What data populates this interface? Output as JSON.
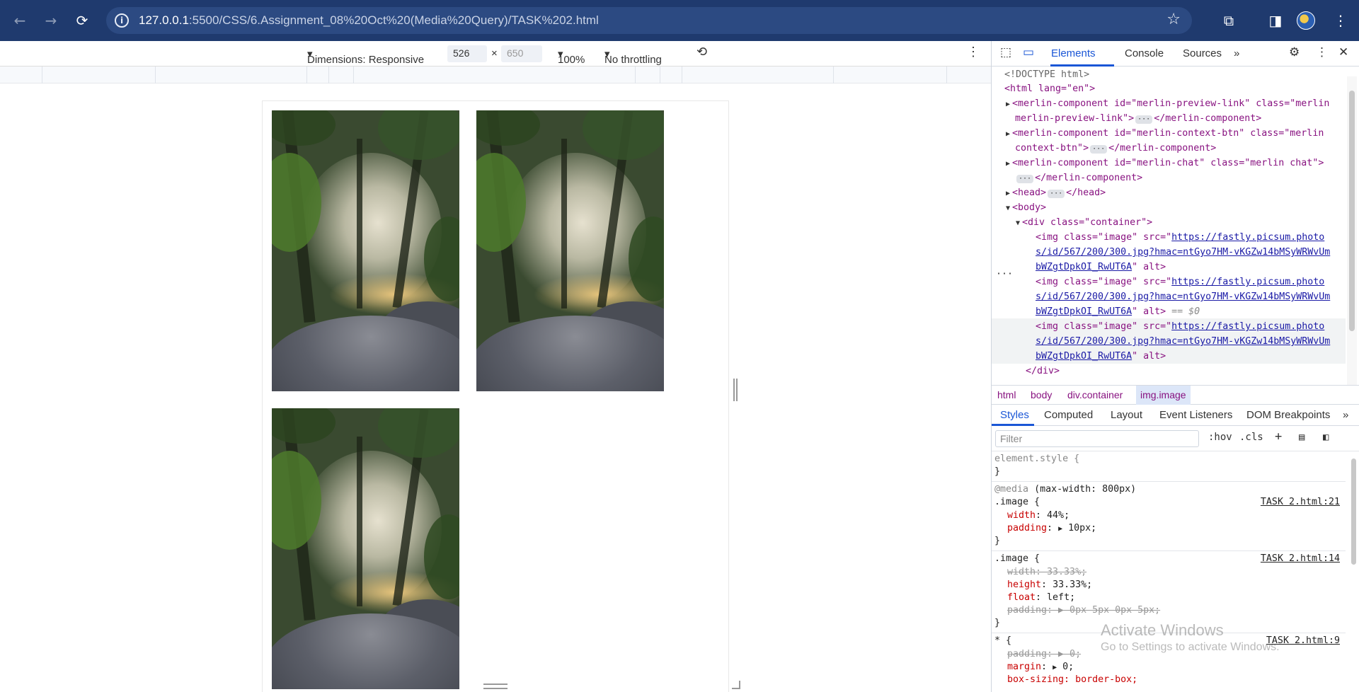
{
  "browser": {
    "url_host": "127.0.0.1",
    "url_path": ":5500/CSS/6.Assignment_08%20Oct%20(Media%20Query)/TASK%202.html"
  },
  "device_toolbar": {
    "dimensions_label": "Dimensions: Responsive",
    "width": "526",
    "height": "650",
    "zoom": "100%",
    "throttling": "No throttling"
  },
  "devtools": {
    "tabs": [
      "Elements",
      "Console",
      "Sources"
    ],
    "active_tab": "Elements",
    "dom": {
      "doctype": "<!DOCTYPE html>",
      "html_open": "<html lang=\"en\">",
      "m1_open": "<merlin-component id=\"merlin-preview-link\" class=\"merlin",
      "m1_cont": "merlin-preview-link\">",
      "m_close": "</merlin-component>",
      "m2_open": "<merlin-component id=\"merlin-context-btn\" class=\"merlin",
      "m2_cont": "context-btn\">",
      "m3_open": "<merlin-component id=\"merlin-chat\" class=\"merlin chat\">",
      "head": "<head>",
      "head_close": "</head>",
      "body_open": "<body>",
      "div_open": "<div class=\"container\">",
      "img_prefix": "<img class=\"image\" src=\"",
      "img_url_1": "https://fastly.picsum.photo",
      "img_url_2": "s/id/567/200/300.jpg?hmac=ntGyo7HM-vKGZw14bMSyWRWvUm",
      "img_url_3": "bWZgtDpkOI_RwUT6A",
      "img_suffix": "\" alt>",
      "selected_marker": "== $0",
      "div_close": "</div>"
    },
    "breadcrumbs": [
      "html",
      "body",
      "div.container",
      "img.image"
    ],
    "styles_tabs": [
      "Styles",
      "Computed",
      "Layout",
      "Event Listeners",
      "DOM Breakpoints"
    ],
    "filter_placeholder": "Filter",
    "hov": ":hov",
    "cls": ".cls",
    "styles": {
      "element_style": "element.style {",
      "close": "}",
      "media_kw": "@media",
      "media_query": "(max-width: 800px)",
      "rule1_selector": ".image {",
      "rule1_source": "TASK 2.html:21",
      "rule1_width_prop": "width",
      "rule1_width_val": "44%;",
      "rule1_padding_prop": "padding",
      "rule1_padding_val": "10px;",
      "rule2_selector": ".image {",
      "rule2_source": "TASK 2.html:14",
      "rule2_width": "width: 33.33%;",
      "rule2_height_prop": "height",
      "rule2_height_val": "33.33%;",
      "rule2_float_prop": "float",
      "rule2_float_val": "left;",
      "rule2_padding": "padding: ▶ 0px 5px 0px 5px;",
      "rule3_selector": "* {",
      "rule3_source": "TASK 2.html:9",
      "rule3_padding": "padding: ▶ 0;",
      "rule3_margin_prop": "margin",
      "rule3_margin_val": "0;",
      "rule3_boxsizing": "box-sizing: border-box;"
    },
    "watermark_title": "Activate Windows",
    "watermark_sub": "Go to Settings to activate Windows."
  }
}
